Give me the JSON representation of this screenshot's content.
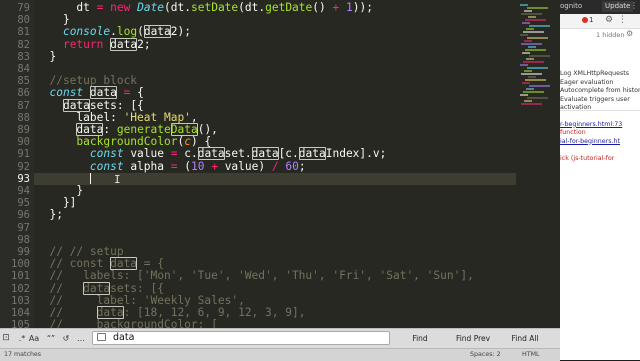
{
  "editor": {
    "line_numbers": [
      "79",
      "80",
      "81",
      "82",
      "83",
      "84",
      "85",
      "86",
      "87",
      "88",
      "89",
      "90",
      "91",
      "92",
      "93",
      "94",
      "95",
      "96",
      "97",
      "98",
      "99",
      "100",
      "101",
      "102",
      "103",
      "104",
      "105"
    ],
    "current_line": "93",
    "lines": [
      [
        {
          "t": "      dt ",
          "c": "prop"
        },
        {
          "t": "=",
          "c": "op"
        },
        {
          "t": " ",
          "c": "prop"
        },
        {
          "t": "new",
          "c": "kw2"
        },
        {
          "t": " ",
          "c": "prop"
        },
        {
          "t": "Date",
          "c": "kw"
        },
        {
          "t": "(dt.",
          "c": "prop"
        },
        {
          "t": "setDate",
          "c": "fn"
        },
        {
          "t": "(dt.",
          "c": "prop"
        },
        {
          "t": "getDate",
          "c": "fn"
        },
        {
          "t": "() ",
          "c": "prop"
        },
        {
          "t": "+",
          "c": "op"
        },
        {
          "t": " ",
          "c": "prop"
        },
        {
          "t": "1",
          "c": "num"
        },
        {
          "t": "));",
          "c": "prop"
        }
      ],
      [
        {
          "t": "    }",
          "c": "prop"
        }
      ],
      [
        {
          "t": "    ",
          "c": "prop"
        },
        {
          "t": "console",
          "c": "kw"
        },
        {
          "t": ".",
          "c": "prop"
        },
        {
          "t": "log",
          "c": "fn"
        },
        {
          "t": "(",
          "c": "prop"
        },
        {
          "t": "data",
          "c": "prop",
          "hl": true
        },
        {
          "t": "2);",
          "c": "prop"
        }
      ],
      [
        {
          "t": "    ",
          "c": "prop"
        },
        {
          "t": "return",
          "c": "kw2"
        },
        {
          "t": " ",
          "c": "prop"
        },
        {
          "t": "data",
          "c": "prop",
          "hl": true
        },
        {
          "t": "2;",
          "c": "prop"
        }
      ],
      [
        {
          "t": "  }",
          "c": "prop"
        }
      ],
      [
        {
          "t": "",
          "c": "prop"
        }
      ],
      [
        {
          "t": "  //setup block",
          "c": "cm"
        }
      ],
      [
        {
          "t": "  ",
          "c": "prop"
        },
        {
          "t": "const",
          "c": "kw"
        },
        {
          "t": " ",
          "c": "prop"
        },
        {
          "t": "data",
          "c": "prop",
          "hl": true
        },
        {
          "t": " ",
          "c": "prop"
        },
        {
          "t": "=",
          "c": "op"
        },
        {
          "t": " {",
          "c": "prop"
        }
      ],
      [
        {
          "t": "    ",
          "c": "prop"
        },
        {
          "t": "data",
          "c": "prop",
          "hl": true
        },
        {
          "t": "sets: [{",
          "c": "prop"
        }
      ],
      [
        {
          "t": "      label: ",
          "c": "prop"
        },
        {
          "t": "'Heat Map'",
          "c": "str"
        },
        {
          "t": ",",
          "c": "prop"
        }
      ],
      [
        {
          "t": "      ",
          "c": "prop"
        },
        {
          "t": "data",
          "c": "prop",
          "hl": true
        },
        {
          "t": ": ",
          "c": "prop"
        },
        {
          "t": "generate",
          "c": "fn"
        },
        {
          "t": "Data",
          "c": "fn",
          "hl": true
        },
        {
          "t": "(),",
          "c": "prop"
        }
      ],
      [
        {
          "t": "      ",
          "c": "prop"
        },
        {
          "t": "backgroundColor",
          "c": "fn"
        },
        {
          "t": "(",
          "c": "prop"
        },
        {
          "t": "c",
          "c": "prm"
        },
        {
          "t": ") {",
          "c": "prop"
        }
      ],
      [
        {
          "t": "        ",
          "c": "prop"
        },
        {
          "t": "const",
          "c": "kw"
        },
        {
          "t": " value ",
          "c": "prop"
        },
        {
          "t": "=",
          "c": "op"
        },
        {
          "t": " c.",
          "c": "prop"
        },
        {
          "t": "data",
          "c": "prop",
          "hl": true
        },
        {
          "t": "set.",
          "c": "prop"
        },
        {
          "t": "data",
          "c": "prop",
          "hl": true
        },
        {
          "t": "[c.",
          "c": "prop"
        },
        {
          "t": "data",
          "c": "prop",
          "hl": true
        },
        {
          "t": "Index].v;",
          "c": "prop"
        }
      ],
      [
        {
          "t": "        ",
          "c": "prop"
        },
        {
          "t": "const",
          "c": "kw"
        },
        {
          "t": " alpha ",
          "c": "prop"
        },
        {
          "t": "=",
          "c": "op"
        },
        {
          "t": " (",
          "c": "prop"
        },
        {
          "t": "10",
          "c": "num"
        },
        {
          "t": " ",
          "c": "prop"
        },
        {
          "t": "+",
          "c": "op"
        },
        {
          "t": " value) ",
          "c": "prop"
        },
        {
          "t": "/",
          "c": "op"
        },
        {
          "t": " ",
          "c": "prop"
        },
        {
          "t": "60",
          "c": "num"
        },
        {
          "t": ";",
          "c": "prop"
        }
      ],
      [
        {
          "t": "        ",
          "c": "prop"
        },
        {
          "t": "",
          "c": "caret"
        }
      ],
      [
        {
          "t": "      }",
          "c": "prop"
        }
      ],
      [
        {
          "t": "    }]",
          "c": "prop"
        }
      ],
      [
        {
          "t": "  };",
          "c": "prop"
        }
      ],
      [
        {
          "t": "",
          "c": "prop"
        }
      ],
      [
        {
          "t": "",
          "c": "prop"
        }
      ],
      [
        {
          "t": "  // // setup",
          "c": "cm"
        }
      ],
      [
        {
          "t": "  // const ",
          "c": "cm"
        },
        {
          "t": "data",
          "c": "cm",
          "hl": true
        },
        {
          "t": " = {",
          "c": "cm"
        }
      ],
      [
        {
          "t": "  //   labels: ['Mon', 'Tue', 'Wed', 'Thu', 'Fri', 'Sat', 'Sun'],",
          "c": "cm"
        }
      ],
      [
        {
          "t": "  //   ",
          "c": "cm"
        },
        {
          "t": "data",
          "c": "cm",
          "hl": true
        },
        {
          "t": "sets: [{",
          "c": "cm"
        }
      ],
      [
        {
          "t": "  //     label: 'Weekly Sales',",
          "c": "cm"
        }
      ],
      [
        {
          "t": "  //     ",
          "c": "cm"
        },
        {
          "t": "data",
          "c": "cm",
          "hl": true
        },
        {
          "t": ": [18, 12, 6, 9, 12, 3, 9],",
          "c": "cm"
        }
      ],
      [
        {
          "t": "  //     backgroundColor: [",
          "c": "cm"
        }
      ]
    ]
  },
  "devtools": {
    "tab_url": "ognito",
    "update_label": "Update",
    "menu_label": "⋮",
    "error_count": "1",
    "gear_icon": "⚙",
    "more_icon": "⋮",
    "hidden_label": "1 hidden",
    "log_lines": [
      {
        "text": "Log XMLHttpRequests",
        "cls": ""
      },
      {
        "text": "Eager evaluation",
        "cls": ""
      },
      {
        "text": "Autocomplete from history",
        "cls": ""
      },
      {
        "text": "Evaluate triggers user",
        "cls": ""
      },
      {
        "text": "activation",
        "cls": ""
      },
      {
        "text": "r-beginners.html:73",
        "cls": "dt-link"
      },
      {
        "text": "function",
        "cls": "dt-red"
      },
      {
        "text": "ial-for-beginners.ht",
        "cls": "dt-link"
      },
      {
        "text": "",
        "cls": ""
      },
      {
        "text": "ick (js-tutorial-for",
        "cls": "dt-red"
      }
    ]
  },
  "findbar": {
    "option_1": "Aa",
    "option_2": "“”",
    "option_3": "…",
    "search_value": "data",
    "find_label": "Find",
    "find_prev_label": "Find Prev",
    "find_all_label": "Find All"
  },
  "statusbar": {
    "matches": "17 matches",
    "spaces": "Spaces: 2",
    "syntax": "HTML"
  },
  "colors": {
    "editor_bg": "#272822",
    "keyword": "#66d9ef",
    "operator": "#f92672",
    "function": "#a6e22e",
    "number": "#ae81ff",
    "string": "#e6db74",
    "comment": "#75715e"
  }
}
